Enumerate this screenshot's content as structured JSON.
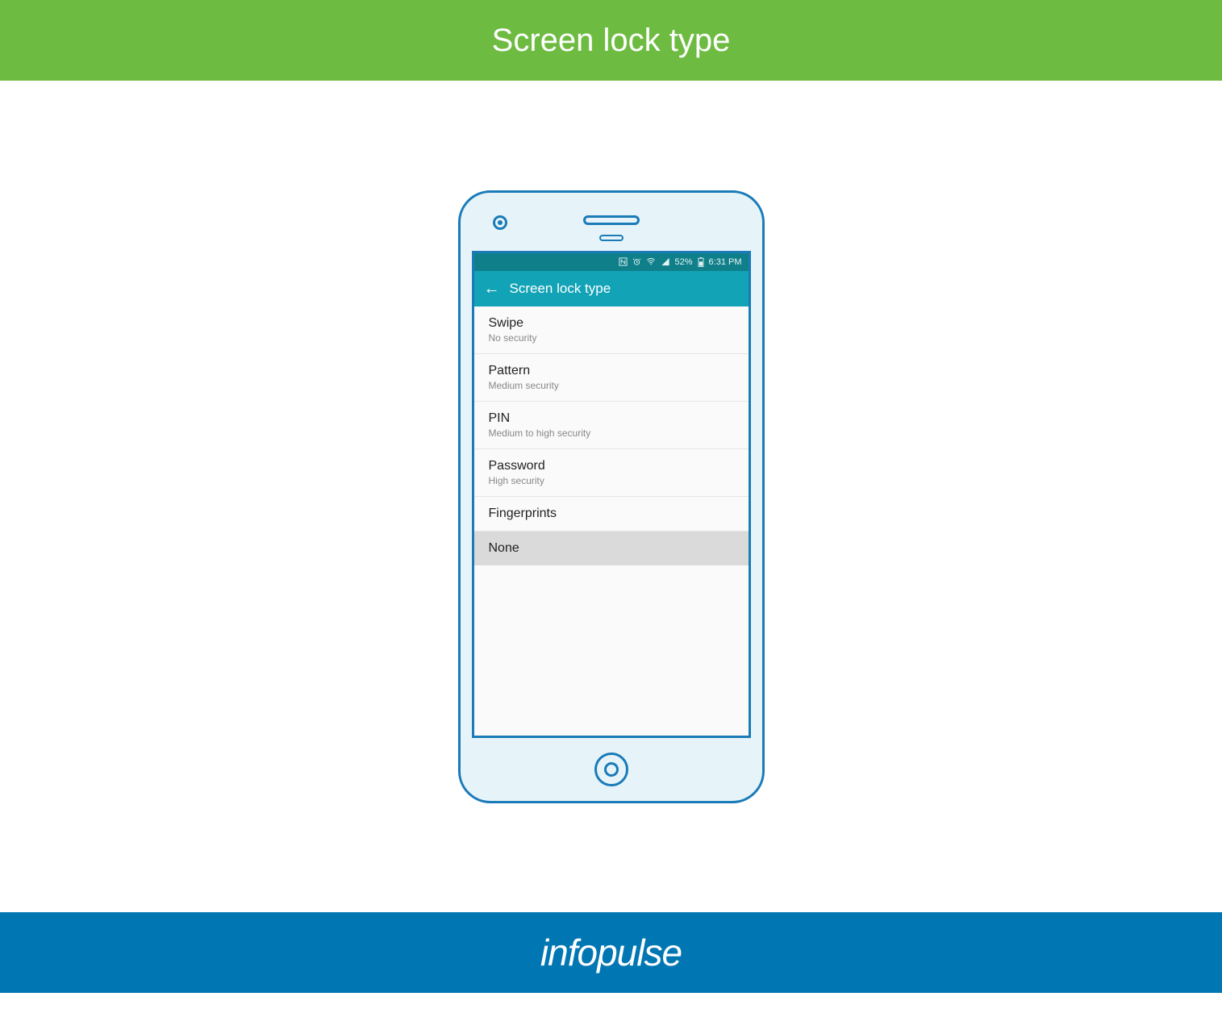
{
  "banner": {
    "top_title": "Screen lock type",
    "bottom_brand": "infopulse"
  },
  "phone": {
    "status_bar": {
      "battery_percent": "52%",
      "time": "6:31 PM",
      "icons_text": "📶"
    },
    "app_bar": {
      "back_glyph": "←",
      "title": "Screen lock type"
    },
    "lock_options": [
      {
        "title": "Swipe",
        "subtitle": "No security",
        "selected": false
      },
      {
        "title": "Pattern",
        "subtitle": "Medium security",
        "selected": false
      },
      {
        "title": "PIN",
        "subtitle": "Medium to high security",
        "selected": false
      },
      {
        "title": "Password",
        "subtitle": "High security",
        "selected": false
      },
      {
        "title": "Fingerprints",
        "subtitle": "",
        "selected": false
      },
      {
        "title": "None",
        "subtitle": "",
        "selected": true
      }
    ]
  }
}
